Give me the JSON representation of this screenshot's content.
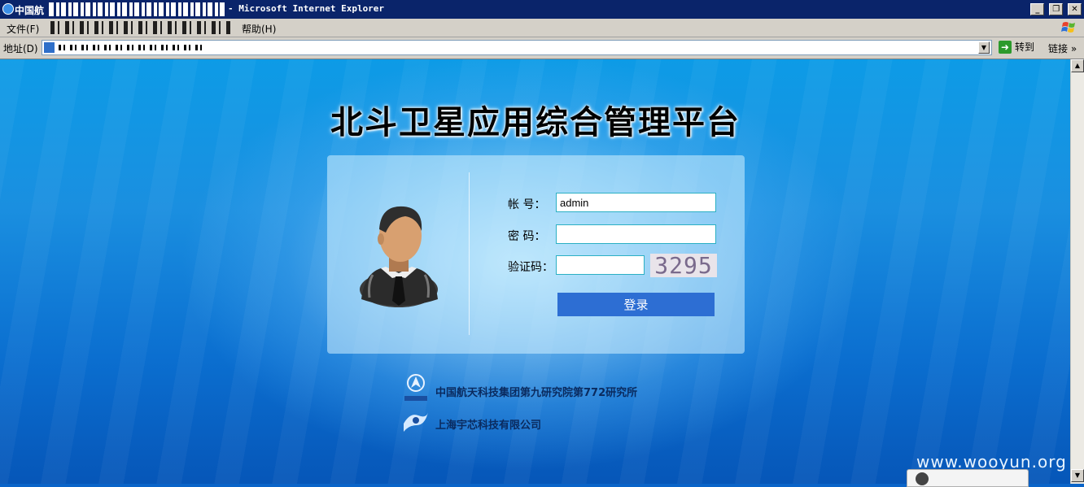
{
  "window": {
    "title_left": "中国航",
    "title_right": "- Microsoft Internet Explorer",
    "buttons": {
      "minimize": "_",
      "restore": "❐",
      "close": "✕"
    }
  },
  "menubar": {
    "file": "文件(F)",
    "help": "帮助(H)"
  },
  "addressbar": {
    "label": "地址(D)",
    "go_label": "转到",
    "links_label": "链接"
  },
  "page": {
    "title": "北斗卫星应用综合管理平台",
    "form": {
      "account_label": "帐    号：",
      "account_value": "admin",
      "password_label": "密    码：",
      "password_value": "",
      "captcha_label": "验证码：",
      "captcha_value": "",
      "captcha_image_text": "3295",
      "login_button": "登录"
    },
    "orgs": [
      {
        "name": "中国航天科技集团第九研究院第772研究所"
      },
      {
        "name": "上海宇芯科技有限公司"
      }
    ]
  },
  "watermark": "www.wooyun.org",
  "colors": {
    "title_bar": "#0a246a",
    "chrome": "#d4d0c8",
    "login_button": "#2d6ed3",
    "input_border": "#2bb0c4"
  },
  "icons": [
    "ie-icon",
    "windows-logo-icon",
    "page-icon",
    "go-arrow-icon",
    "user-avatar-icon",
    "casc-logo-icon",
    "yuxin-logo-icon"
  ]
}
